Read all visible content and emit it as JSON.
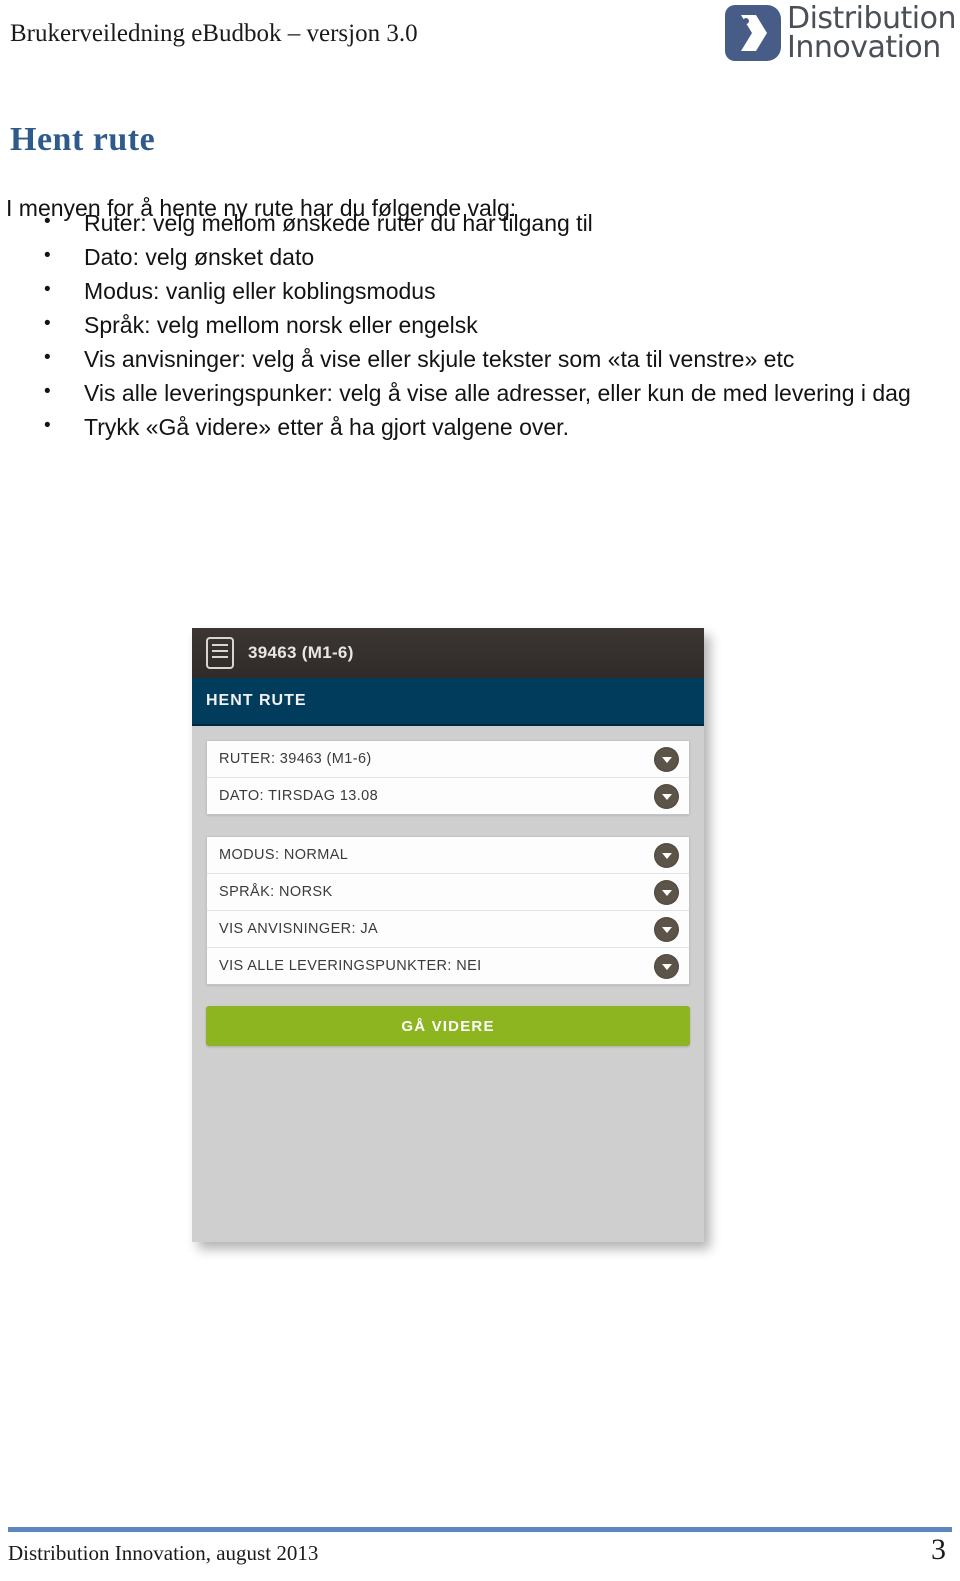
{
  "header": {
    "running_title": "Brukerveiledning eBudbok – versjon 3.0",
    "logo": {
      "icon": "chevron-right-logo-icon",
      "line1": "Distribution",
      "line2": "Innovation",
      "mark_color": "#475d87",
      "text_color": "#4a4f58"
    }
  },
  "page": {
    "title": "Hent rute",
    "title_color": "#2e5b8c",
    "intro": "I menyen for å hente ny rute har du følgende valg:",
    "bullets": [
      "Ruter: velg mellom ønskede ruter du har tilgang til",
      "Dato: velg ønsket dato",
      "Modus: vanlig eller koblingsmodus",
      "Språk: velg mellom norsk eller engelsk",
      "Vis anvisninger: velg å vise eller skjule tekster som «ta til venstre» etc",
      "Vis alle leveringspunker: velg å vise alle adresser, eller kun de med levering i dag",
      "Trykk «Gå videre» etter å ha gjort valgene over."
    ]
  },
  "app_screenshot": {
    "topbar": {
      "icon": "list-document-icon",
      "title": "39463 (M1-6)",
      "background": "#302b28"
    },
    "section_header": {
      "label": "HENT RUTE",
      "background": "#013c5d"
    },
    "groups": [
      {
        "rows": [
          {
            "label": "RUTER: 39463 (M1-6)",
            "control": "chevron-down-icon"
          },
          {
            "label": "DATO: TIRSDAG 13.08",
            "control": "chevron-down-icon"
          }
        ]
      },
      {
        "rows": [
          {
            "label": "MODUS: NORMAL",
            "control": "chevron-down-icon"
          },
          {
            "label": "SPRÅK: NORSK",
            "control": "chevron-down-icon"
          },
          {
            "label": "VIS ANVISNINGER: JA",
            "control": "chevron-down-icon"
          },
          {
            "label": "VIS ALLE LEVERINGSPUNKTER: NEI",
            "control": "chevron-down-icon"
          }
        ]
      }
    ],
    "primary_button": {
      "label": "GÅ VIDERE",
      "color": "#8cb51f"
    }
  },
  "footer": {
    "left": "Distribution Innovation, august 2013",
    "page_number": "3",
    "rule_color": "#5b87be"
  }
}
